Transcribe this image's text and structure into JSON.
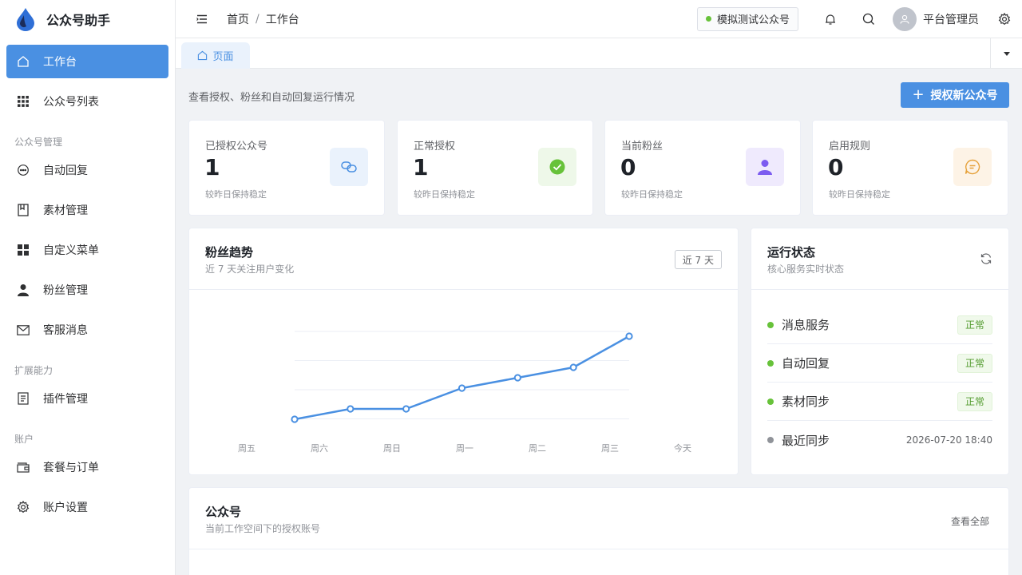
{
  "app": {
    "name": "公众号助手"
  },
  "sidebar": {
    "items": [
      {
        "label": "工作台",
        "icon": "home-icon",
        "active": true
      },
      {
        "label": "公众号列表",
        "icon": "grid-icon"
      }
    ],
    "groups": [
      {
        "title": "公众号管理",
        "items": [
          {
            "label": "自动回复",
            "icon": "chat-icon"
          },
          {
            "label": "素材管理",
            "icon": "bookmark-icon"
          },
          {
            "label": "自定义菜单",
            "icon": "menu-grid-icon"
          },
          {
            "label": "粉丝管理",
            "icon": "user-icon"
          },
          {
            "label": "客服消息",
            "icon": "mail-icon"
          }
        ]
      },
      {
        "title": "扩展能力",
        "items": [
          {
            "label": "插件管理",
            "icon": "document-icon"
          }
        ]
      },
      {
        "title": "账户",
        "items": [
          {
            "label": "套餐与订单",
            "icon": "wallet-icon"
          },
          {
            "label": "账户设置",
            "icon": "gear-icon"
          }
        ]
      }
    ]
  },
  "header": {
    "breadcrumb": [
      "首页",
      "工作台"
    ],
    "breadcrumb_sep": "/",
    "account_tag": "模拟测试公众号",
    "user_name": "平台管理员"
  },
  "tabs": [
    {
      "label": "页面"
    }
  ],
  "page": {
    "subtitle": "查看授权、粉丝和自动回复运行情况",
    "primary_button": "授权新公众号"
  },
  "stats": [
    {
      "label": "已授权公众号",
      "value": "1",
      "note": "较昨日保持稳定",
      "icon": "link-icon",
      "icon_color": "#4a90e2",
      "icon_bg": "#eaf2fc"
    },
    {
      "label": "正常授权",
      "value": "1",
      "note": "较昨日保持稳定",
      "icon": "check-circle-icon",
      "icon_color": "#67c23a",
      "icon_bg": "#eef8e9"
    },
    {
      "label": "当前粉丝",
      "value": "0",
      "note": "较昨日保持稳定",
      "icon": "user-icon",
      "icon_color": "#7c5cf0",
      "icon_bg": "#efeafd"
    },
    {
      "label": "启用规则",
      "value": "0",
      "note": "较昨日保持稳定",
      "icon": "chat-icon",
      "icon_color": "#e6a23c",
      "icon_bg": "#fdf3e6"
    }
  ],
  "fans_trend": {
    "title": "粉丝趋势",
    "subtitle": "近 7 天关注用户变化",
    "range_button": "近 7 天"
  },
  "chart_data": {
    "type": "line",
    "categories": [
      "周五",
      "周六",
      "周日",
      "周一",
      "周二",
      "周三",
      "今天"
    ],
    "series": [
      {
        "values": [
          0,
          1,
          1,
          3,
          4,
          5,
          8
        ]
      }
    ],
    "title": "",
    "xlabel": "",
    "ylabel": "",
    "ylim": [
      0,
      10
    ],
    "grid": true,
    "color": "#4a90e2"
  },
  "run_status": {
    "title": "运行状态",
    "subtitle": "核心服务实时状态",
    "rows": [
      {
        "name": "消息服务",
        "badge": "正常",
        "dot_color": "#67c23a"
      },
      {
        "name": "自动回复",
        "badge": "正常",
        "dot_color": "#67c23a"
      },
      {
        "name": "素材同步",
        "badge": "正常",
        "dot_color": "#67c23a"
      },
      {
        "name": "最近同步",
        "time": "2026-07-20 18:40",
        "dot_color": "#909399"
      }
    ]
  },
  "accounts_panel": {
    "title": "公众号",
    "subtitle": "当前工作空间下的授权账号",
    "view_all": "查看全部"
  }
}
